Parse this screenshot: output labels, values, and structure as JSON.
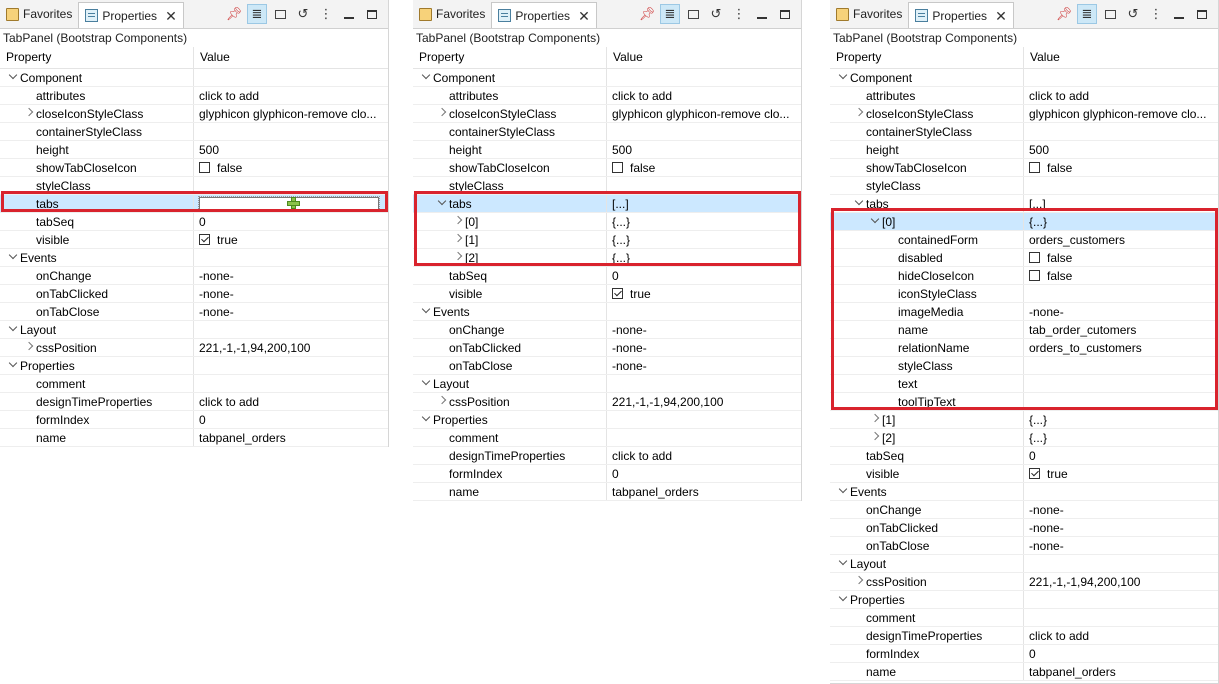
{
  "tabs": {
    "favorites": "Favorites",
    "properties": "Properties"
  },
  "panel_title": "TabPanel (Bootstrap Components)",
  "columns": {
    "property": "Property",
    "value": "Value"
  },
  "colors": {
    "highlight": "#d9232d",
    "selection": "#cce8ff"
  },
  "panels": [
    {
      "rows": [
        {
          "k": "Component",
          "d": 0,
          "tw": "exp",
          "v": ""
        },
        {
          "k": "attributes",
          "d": 1,
          "v": "click to add"
        },
        {
          "k": "closeIconStyleClass",
          "d": 1,
          "tw": "col",
          "v": "glyphicon glyphicon-remove clo..."
        },
        {
          "k": "containerStyleClass",
          "d": 1,
          "v": ""
        },
        {
          "k": "height",
          "d": 1,
          "v": "500"
        },
        {
          "k": "showTabCloseIcon",
          "d": 1,
          "cb": false,
          "v": "false"
        },
        {
          "k": "styleClass",
          "d": 1,
          "v": ""
        },
        {
          "k": "tabs",
          "d": 1,
          "sel": true,
          "edit": true,
          "v": ""
        },
        {
          "k": "tabSeq",
          "d": 1,
          "v": "0"
        },
        {
          "k": "visible",
          "d": 1,
          "cb": true,
          "v": "true"
        },
        {
          "k": "Events",
          "d": 0,
          "tw": "exp",
          "v": ""
        },
        {
          "k": "onChange",
          "d": 1,
          "v": "-none-"
        },
        {
          "k": "onTabClicked",
          "d": 1,
          "v": "-none-"
        },
        {
          "k": "onTabClose",
          "d": 1,
          "v": "-none-"
        },
        {
          "k": "Layout",
          "d": 0,
          "tw": "exp",
          "v": ""
        },
        {
          "k": "cssPosition",
          "d": 1,
          "tw": "col",
          "v": "221,-1,-1,94,200,100"
        },
        {
          "k": "Properties",
          "d": 0,
          "tw": "exp",
          "v": ""
        },
        {
          "k": "comment",
          "d": 1,
          "v": ""
        },
        {
          "k": "designTimeProperties",
          "d": 1,
          "v": "click to add"
        },
        {
          "k": "formIndex",
          "d": 1,
          "v": "0"
        },
        {
          "k": "name",
          "d": 1,
          "v": "tabpanel_orders"
        }
      ]
    },
    {
      "rows": [
        {
          "k": "Component",
          "d": 0,
          "tw": "exp",
          "v": ""
        },
        {
          "k": "attributes",
          "d": 1,
          "v": "click to add"
        },
        {
          "k": "closeIconStyleClass",
          "d": 1,
          "tw": "col",
          "v": "glyphicon glyphicon-remove clo..."
        },
        {
          "k": "containerStyleClass",
          "d": 1,
          "v": ""
        },
        {
          "k": "height",
          "d": 1,
          "v": "500"
        },
        {
          "k": "showTabCloseIcon",
          "d": 1,
          "cb": false,
          "v": "false"
        },
        {
          "k": "styleClass",
          "d": 1,
          "v": ""
        },
        {
          "k": "tabs",
          "d": 1,
          "tw": "exp",
          "sel": true,
          "v": "[...]"
        },
        {
          "k": "[0]",
          "d": 2,
          "tw": "col",
          "v": "{...}"
        },
        {
          "k": "[1]",
          "d": 2,
          "tw": "col",
          "v": "{...}"
        },
        {
          "k": "[2]",
          "d": 2,
          "tw": "col",
          "v": "{...}"
        },
        {
          "k": "tabSeq",
          "d": 1,
          "v": "0"
        },
        {
          "k": "visible",
          "d": 1,
          "cb": true,
          "v": "true"
        },
        {
          "k": "Events",
          "d": 0,
          "tw": "exp",
          "v": ""
        },
        {
          "k": "onChange",
          "d": 1,
          "v": "-none-"
        },
        {
          "k": "onTabClicked",
          "d": 1,
          "v": "-none-"
        },
        {
          "k": "onTabClose",
          "d": 1,
          "v": "-none-"
        },
        {
          "k": "Layout",
          "d": 0,
          "tw": "exp",
          "v": ""
        },
        {
          "k": "cssPosition",
          "d": 1,
          "tw": "col",
          "v": "221,-1,-1,94,200,100"
        },
        {
          "k": "Properties",
          "d": 0,
          "tw": "exp",
          "v": ""
        },
        {
          "k": "comment",
          "d": 1,
          "v": ""
        },
        {
          "k": "designTimeProperties",
          "d": 1,
          "v": "click to add"
        },
        {
          "k": "formIndex",
          "d": 1,
          "v": "0"
        },
        {
          "k": "name",
          "d": 1,
          "v": "tabpanel_orders"
        }
      ]
    },
    {
      "rows": [
        {
          "k": "Component",
          "d": 0,
          "tw": "exp",
          "v": ""
        },
        {
          "k": "attributes",
          "d": 1,
          "v": "click to add"
        },
        {
          "k": "closeIconStyleClass",
          "d": 1,
          "tw": "col",
          "v": "glyphicon glyphicon-remove clo..."
        },
        {
          "k": "containerStyleClass",
          "d": 1,
          "v": ""
        },
        {
          "k": "height",
          "d": 1,
          "v": "500"
        },
        {
          "k": "showTabCloseIcon",
          "d": 1,
          "cb": false,
          "v": "false"
        },
        {
          "k": "styleClass",
          "d": 1,
          "v": ""
        },
        {
          "k": "tabs",
          "d": 1,
          "tw": "exp",
          "v": "[...]"
        },
        {
          "k": "[0]",
          "d": 2,
          "tw": "exp",
          "sel": true,
          "v": "{...}"
        },
        {
          "k": "containedForm",
          "d": 3,
          "v": "orders_customers"
        },
        {
          "k": "disabled",
          "d": 3,
          "cb": false,
          "v": "false"
        },
        {
          "k": "hideCloseIcon",
          "d": 3,
          "cb": false,
          "v": "false"
        },
        {
          "k": "iconStyleClass",
          "d": 3,
          "v": ""
        },
        {
          "k": "imageMedia",
          "d": 3,
          "v": "-none-"
        },
        {
          "k": "name",
          "d": 3,
          "v": "tab_order_cutomers"
        },
        {
          "k": "relationName",
          "d": 3,
          "v": "orders_to_customers"
        },
        {
          "k": "styleClass",
          "d": 3,
          "v": ""
        },
        {
          "k": "text",
          "d": 3,
          "v": ""
        },
        {
          "k": "toolTipText",
          "d": 3,
          "v": ""
        },
        {
          "k": "[1]",
          "d": 2,
          "tw": "col",
          "v": "{...}"
        },
        {
          "k": "[2]",
          "d": 2,
          "tw": "col",
          "v": "{...}"
        },
        {
          "k": "tabSeq",
          "d": 1,
          "v": "0"
        },
        {
          "k": "visible",
          "d": 1,
          "cb": true,
          "v": "true"
        },
        {
          "k": "Events",
          "d": 0,
          "tw": "exp",
          "v": ""
        },
        {
          "k": "onChange",
          "d": 1,
          "v": "-none-"
        },
        {
          "k": "onTabClicked",
          "d": 1,
          "v": "-none-"
        },
        {
          "k": "onTabClose",
          "d": 1,
          "v": "-none-"
        },
        {
          "k": "Layout",
          "d": 0,
          "tw": "exp",
          "v": ""
        },
        {
          "k": "cssPosition",
          "d": 1,
          "tw": "col",
          "v": "221,-1,-1,94,200,100"
        },
        {
          "k": "Properties",
          "d": 0,
          "tw": "exp",
          "v": ""
        },
        {
          "k": "comment",
          "d": 1,
          "v": ""
        },
        {
          "k": "designTimeProperties",
          "d": 1,
          "v": "click to add"
        },
        {
          "k": "formIndex",
          "d": 1,
          "v": "0"
        },
        {
          "k": "name",
          "d": 1,
          "v": "tabpanel_orders"
        }
      ]
    }
  ]
}
